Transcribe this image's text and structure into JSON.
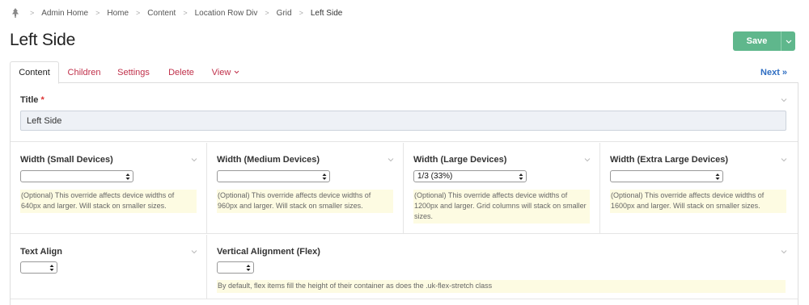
{
  "breadcrumb": {
    "icon": "tree-icon",
    "items": [
      "Admin Home",
      "Home",
      "Content",
      "Location Row Div",
      "Grid"
    ],
    "current": "Left Side"
  },
  "page": {
    "title": "Left Side"
  },
  "actions": {
    "save_label": "Save",
    "accent": "#5fb78c"
  },
  "tabs": {
    "items": [
      "Content",
      "Children",
      "Settings",
      "Delete",
      "View"
    ],
    "next_label": "Next"
  },
  "fields": {
    "title": {
      "label": "Title",
      "required_mark": "*",
      "value": "Left Side"
    },
    "width_small": {
      "label": "Width (Small Devices)",
      "value": "",
      "help": "(Optional) This override affects device widths of 640px and larger. Will stack on smaller sizes."
    },
    "width_medium": {
      "label": "Width (Medium Devices)",
      "value": "",
      "help": "(Optional) This override affects device widths of 960px and larger. Will stack on smaller sizes."
    },
    "width_large": {
      "label": "Width (Large Devices)",
      "value": "1/3 (33%)",
      "help": "(Optional) This override affects device widths of 1200px and larger. Grid columns will stack on smaller sizes."
    },
    "width_xlarge": {
      "label": "Width (Extra Large Devices)",
      "value": "",
      "help": "(Optional) This override affects device widths of 1600px and larger. Will stack on smaller sizes."
    },
    "text_align": {
      "label": "Text Align",
      "value": ""
    },
    "vertical_alignment": {
      "label": "Vertical Alignment (Flex)",
      "value": "",
      "help": "By default, flex items fill the height of their container as does the .uk-flex-stretch class"
    }
  }
}
